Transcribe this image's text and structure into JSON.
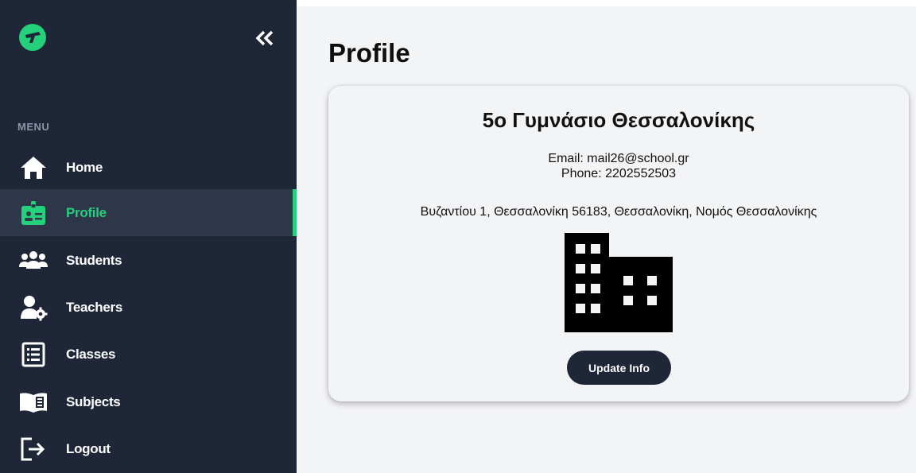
{
  "sidebar": {
    "menu_label": "MENU",
    "items": [
      {
        "label": "Home",
        "icon": "home-icon"
      },
      {
        "label": "Profile",
        "icon": "id-badge-icon",
        "active": true
      },
      {
        "label": "Students",
        "icon": "users-icon"
      },
      {
        "label": "Teachers",
        "icon": "user-gear-icon"
      },
      {
        "label": "Classes",
        "icon": "list-box-icon"
      },
      {
        "label": "Subjects",
        "icon": "book-icon"
      },
      {
        "label": "Logout",
        "icon": "logout-icon"
      }
    ]
  },
  "page": {
    "title": "Profile"
  },
  "profile": {
    "name": "5ο Γυμνάσιο Θεσσαλονίκης",
    "email_line": "Email: mail26@school.gr",
    "phone_line": "Phone: 2202552503",
    "address": "Βυζαντίου 1, Θεσσαλονίκη 56183, Θεσσαλονίκη, Νομός Θεσσαλονίκης",
    "update_button": "Update Info"
  },
  "colors": {
    "sidebar_bg": "#1e2637",
    "active_bg": "#2d3749",
    "accent": "#24d07a",
    "page_bg": "#f3f4f6"
  }
}
